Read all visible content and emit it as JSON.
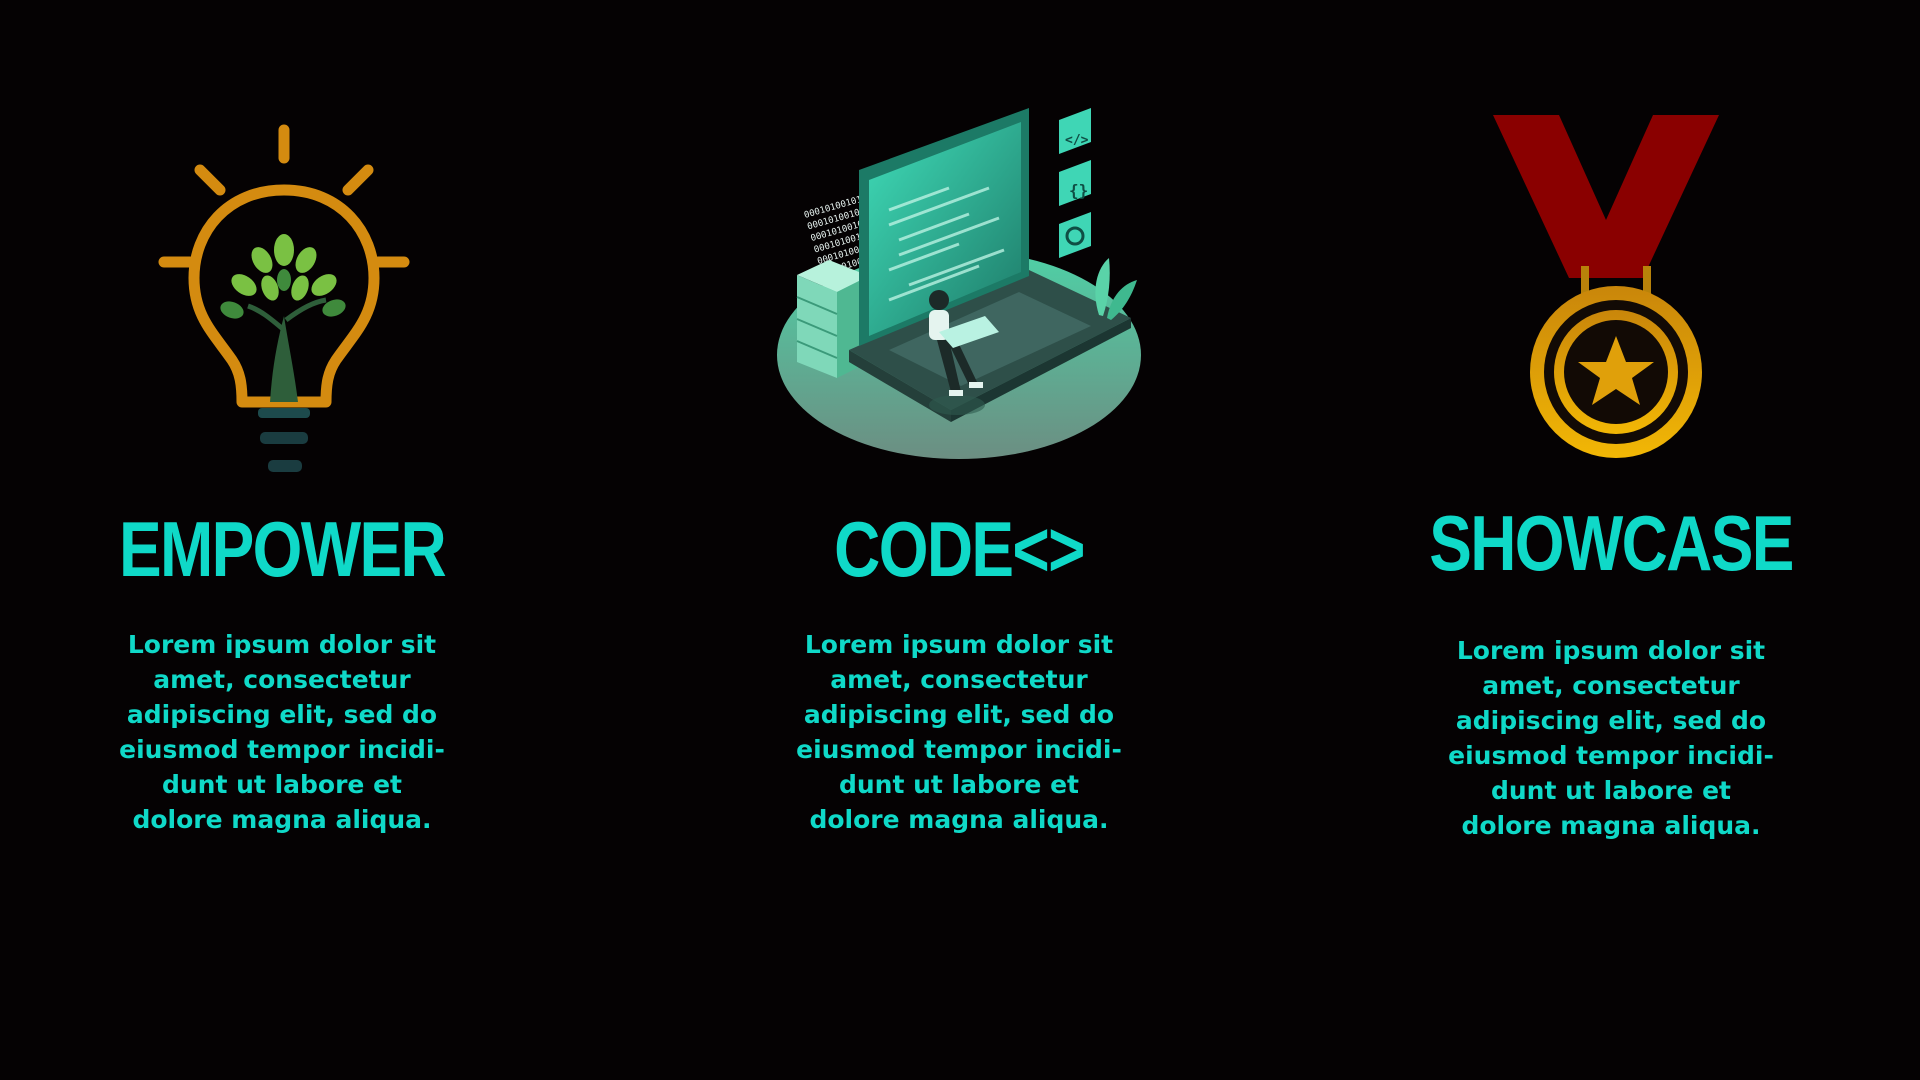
{
  "colors": {
    "background": "#050203",
    "accent": "#0fd9c8",
    "bulb": "#d48b10",
    "ribbon": "#8a0000",
    "medal": "#e6a40a"
  },
  "columns": [
    {
      "icon": "lightbulb-tree-icon",
      "title": "EMPOWER",
      "description": "Lorem ipsum dolor sit\namet, consectetur\nadipiscing elit, sed do\neiusmod tempor incidi-\ndunt ut labore et\ndolore magna aliqua."
    },
    {
      "icon": "isometric-laptop-coder-icon",
      "title": "CODE<>",
      "description": "Lorem ipsum dolor sit\namet, consectetur\nadipiscing elit, sed do\neiusmod tempor incidi-\ndunt ut labore et\ndolore magna aliqua."
    },
    {
      "icon": "medal-star-icon",
      "title": "SHOWCASE",
      "description": "Lorem ipsum dolor sit\namet, consectetur\nadipiscing elit, sed do\neiusmod tempor incidi-\ndunt ut labore et\ndolore magna aliqua."
    }
  ],
  "code_binary": "0001010010111010111011010100010101"
}
